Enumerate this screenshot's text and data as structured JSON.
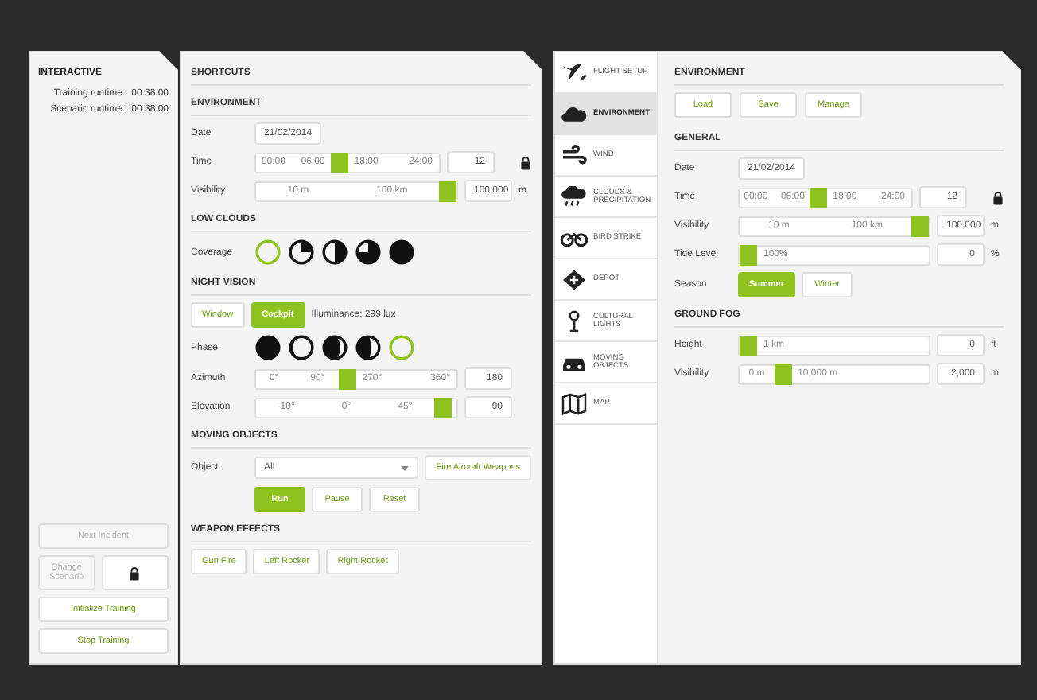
{
  "interactive": {
    "title": "INTERACTIVE",
    "runtimes": [
      {
        "label": "Training runtime:",
        "value": "00:38:00"
      },
      {
        "label": "Scenario runtime:",
        "value": "00:38:00"
      }
    ],
    "buttons": [
      {
        "label": "Next Incident",
        "disabled": true,
        "kind": "text"
      },
      {
        "label": "Change Scenario",
        "disabled": true,
        "kind": "text"
      },
      {
        "kind": "lock"
      },
      {
        "label": "Initialize Training",
        "disabled": false,
        "kind": "text"
      },
      {
        "label": "Stop Training",
        "disabled": false,
        "kind": "text"
      }
    ]
  },
  "shortcuts": {
    "title": "SHORTCUTS",
    "sections": [
      {
        "title": "ENVIRONMENT",
        "rows": [
          {
            "kind": "date",
            "label": "Date",
            "value": "21/02/2014"
          },
          {
            "kind": "slider",
            "label": "Time",
            "ticks": [
              "00:00",
              "06:00",
              "18:00",
              "24:00"
            ],
            "level": 0.45,
            "value": "12",
            "lock": true
          },
          {
            "kind": "slider",
            "label": "Visibility",
            "ticks": [
              "10 m",
              "100 km"
            ],
            "level": 1,
            "value": "100,000",
            "unit": "m"
          }
        ]
      },
      {
        "title": "LOW CLOUDS",
        "rows": [
          {
            "kind": "coverage",
            "label": "Coverage",
            "items": [
              {
                "selected": true
              },
              {
                "selected": false
              },
              {
                "selected": false
              },
              {
                "selected": false
              },
              {
                "selected": false
              }
            ]
          }
        ]
      },
      {
        "title": "NIGHT VISION",
        "rows": [
          {
            "kind": "toggle",
            "items": [
              {
                "label": "Window",
                "selected": false
              },
              {
                "label": "Cockpit",
                "selected": true
              }
            ],
            "note": "Illuminance: 299 lux"
          },
          {
            "kind": "phase",
            "label": "Phase",
            "items": [
              {
                "selected": false
              },
              {
                "selected": false
              },
              {
                "selected": false
              },
              {
                "selected": false
              },
              {
                "selected": true
              }
            ]
          },
          {
            "kind": "slider",
            "label": "Azimuth",
            "ticks": [
              "0°",
              "90°",
              "270°",
              "360°"
            ],
            "level": 0.45,
            "value": "180"
          },
          {
            "kind": "slider",
            "label": "Elevation",
            "ticks": [
              "-10°",
              "0°",
              "45°"
            ],
            "level": 0.97,
            "value": "90"
          }
        ]
      },
      {
        "title": "MOVING OBJECTS",
        "rows": [
          {
            "kind": "select",
            "label": "Object",
            "value": "All",
            "button": "Fire Aircraft Weapons"
          },
          {
            "kind": "playback",
            "items": [
              {
                "label": "Run",
                "selected": true
              },
              {
                "label": "Pause",
                "selected": false
              },
              {
                "label": "Reset",
                "selected": false
              }
            ]
          }
        ]
      },
      {
        "title": "WEAPON EFFECTS",
        "rows": [
          {
            "kind": "toggle",
            "items": [
              {
                "label": "Gun Fire",
                "selected": false
              },
              {
                "label": "Left Rocket",
                "selected": false
              },
              {
                "label": "Right Rocket",
                "selected": false
              }
            ]
          }
        ]
      }
    ]
  },
  "setup": {
    "tabs": [
      {
        "label": "FLIGHT SETUP",
        "kind": "plane",
        "selected": false
      },
      {
        "label": "ENVIRONMENT",
        "kind": "cloud",
        "selected": true
      },
      {
        "label": "WIND",
        "kind": "wind",
        "selected": false
      },
      {
        "label": "CLOUDS & PRECIPITATION",
        "kind": "rain",
        "selected": false
      },
      {
        "label": "BIRD STRIKE",
        "kind": "bird",
        "selected": false
      },
      {
        "label": "DEPOT",
        "kind": "diamond",
        "selected": false
      },
      {
        "label": "CULTURAL LIGHTS",
        "kind": "light",
        "selected": false
      },
      {
        "label": "MOVING OBJECTS",
        "kind": "car",
        "selected": false
      },
      {
        "label": "MAP",
        "kind": "map",
        "selected": false
      }
    ],
    "title": "ENVIRONMENT",
    "actions": [
      "Load",
      "Save",
      "Manage"
    ],
    "sections": [
      {
        "title": "GENERAL",
        "rows": [
          {
            "kind": "date",
            "label": "Date",
            "value": "21/02/2014"
          },
          {
            "kind": "slider",
            "label": "Time",
            "ticks": [
              "00:00",
              "06:00",
              "18:00",
              "24:00"
            ],
            "level": 0.45,
            "value": "12",
            "lock": true
          },
          {
            "kind": "slider",
            "label": "Visibility",
            "ticks": [
              "10 m",
              "100 km"
            ],
            "level": 1,
            "value": "100,000",
            "unit": "m"
          },
          {
            "kind": "slider",
            "label": "Tide Level",
            "ticks": [
              "100%"
            ],
            "level": 0,
            "value": "0",
            "unit": "%"
          },
          {
            "kind": "toggle",
            "label": "Season",
            "items": [
              {
                "label": "Summer",
                "selected": true
              },
              {
                "label": "Winter",
                "selected": false
              }
            ]
          }
        ]
      },
      {
        "title": "GROUND FOG",
        "rows": [
          {
            "kind": "slider",
            "label": "Height",
            "ticks": [
              "1 km"
            ],
            "level": 0,
            "value": "0",
            "unit": "ft"
          },
          {
            "kind": "slider",
            "label": "Visibility",
            "ticks": [
              "0 m",
              "10,000 m"
            ],
            "level": 0.2,
            "value": "2,000",
            "unit": "m"
          }
        ]
      }
    ]
  }
}
